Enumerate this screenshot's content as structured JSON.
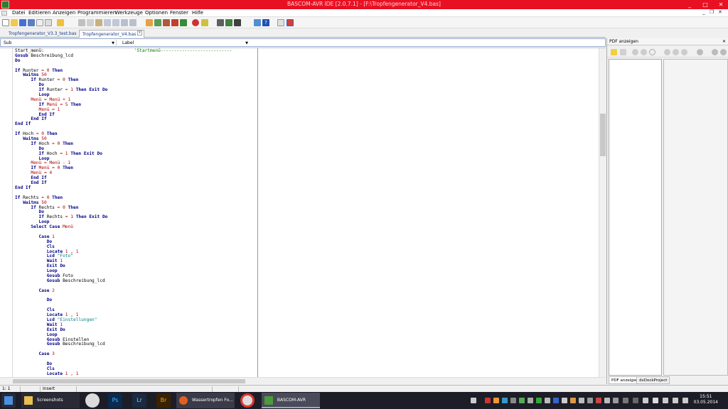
{
  "window": {
    "title": "BASCOM-AVR IDE [2.0.7.1] - [F:\\Tropfengenerator_V4.bas]",
    "min": "_",
    "max": "□",
    "close": "✕"
  },
  "menu": {
    "items": [
      "Datei",
      "Editieren",
      "Anzeigen",
      "Programmieren",
      "Werkzeuge",
      "Optionen",
      "Fenster",
      "Hilfe"
    ],
    "doc_min": "_",
    "doc_restore": "❐",
    "doc_close": "✕"
  },
  "tabs": [
    {
      "label": "Tropfengenerator_V3.3_test.bas"
    },
    {
      "label": "Tropfengenerator_V4.bas"
    }
  ],
  "selectors": {
    "sub": "Sub",
    "label": "Label"
  },
  "code_lines": [
    [
      [
        "t",
        "Start_menü:"
      ],
      [
        "pad",
        "                                  "
      ],
      [
        "cm",
        "'Startmenü---------------------------"
      ]
    ],
    [
      [
        "kw",
        "Gosub"
      ],
      [
        "t",
        " Beschreibung_lcd"
      ]
    ],
    [
      [
        "kw",
        "Do"
      ]
    ],
    [
      [
        "t",
        ""
      ]
    ],
    [
      [
        "kw",
        "If"
      ],
      [
        "t",
        " Runter "
      ],
      [
        "num",
        "= 0"
      ],
      [
        "kw",
        " Then"
      ]
    ],
    [
      [
        "t",
        "   "
      ],
      [
        "kw",
        "Waitms"
      ],
      [
        "num",
        " 50"
      ]
    ],
    [
      [
        "t",
        "      "
      ],
      [
        "kw",
        "If"
      ],
      [
        "t",
        " Runter "
      ],
      [
        "num",
        "= 0"
      ],
      [
        "kw",
        " Then"
      ]
    ],
    [
      [
        "t",
        "         "
      ],
      [
        "kw",
        "Do"
      ]
    ],
    [
      [
        "t",
        "         "
      ],
      [
        "kw",
        "If"
      ],
      [
        "t",
        " Runter "
      ],
      [
        "num",
        "= 1"
      ],
      [
        "kw",
        " Then Exit Do"
      ]
    ],
    [
      [
        "t",
        "         "
      ],
      [
        "kw",
        "Loop"
      ]
    ],
    [
      [
        "t",
        "      "
      ],
      [
        "var",
        "Menü"
      ],
      [
        "num",
        " = "
      ],
      [
        "var",
        "Menü"
      ],
      [
        "num",
        " + 1"
      ]
    ],
    [
      [
        "t",
        "         "
      ],
      [
        "kw",
        "If"
      ],
      [
        "var",
        " Menü"
      ],
      [
        "num",
        " = 5"
      ],
      [
        "kw",
        " Then"
      ]
    ],
    [
      [
        "t",
        "         "
      ],
      [
        "var",
        "Menü"
      ],
      [
        "num",
        " = 1"
      ]
    ],
    [
      [
        "t",
        "         "
      ],
      [
        "kw",
        "End If"
      ]
    ],
    [
      [
        "t",
        "      "
      ],
      [
        "kw",
        "End If"
      ]
    ],
    [
      [
        "kw",
        "End If"
      ]
    ],
    [
      [
        "t",
        ""
      ]
    ],
    [
      [
        "kw",
        "If"
      ],
      [
        "t",
        " Hoch "
      ],
      [
        "num",
        "= 0"
      ],
      [
        "kw",
        " Then"
      ]
    ],
    [
      [
        "t",
        "   "
      ],
      [
        "kw",
        "Waitms"
      ],
      [
        "num",
        " 50"
      ]
    ],
    [
      [
        "t",
        "      "
      ],
      [
        "kw",
        "If"
      ],
      [
        "t",
        " Hoch "
      ],
      [
        "num",
        "= 0"
      ],
      [
        "kw",
        " Then"
      ]
    ],
    [
      [
        "t",
        "         "
      ],
      [
        "kw",
        "Do"
      ]
    ],
    [
      [
        "t",
        "         "
      ],
      [
        "kw",
        "If"
      ],
      [
        "t",
        " Hoch "
      ],
      [
        "num",
        "= 1"
      ],
      [
        "kw",
        " Then Exit Do"
      ]
    ],
    [
      [
        "t",
        "         "
      ],
      [
        "kw",
        "Loop"
      ]
    ],
    [
      [
        "t",
        "      "
      ],
      [
        "var",
        "Menü"
      ],
      [
        "num",
        " = "
      ],
      [
        "var",
        "Menü"
      ],
      [
        "num",
        " - 1"
      ]
    ],
    [
      [
        "t",
        "      "
      ],
      [
        "kw",
        "If"
      ],
      [
        "var",
        " Menü"
      ],
      [
        "num",
        " = 0"
      ],
      [
        "kw",
        " Then"
      ]
    ],
    [
      [
        "t",
        "      "
      ],
      [
        "var",
        "Menü"
      ],
      [
        "num",
        " = 4"
      ]
    ],
    [
      [
        "t",
        "      "
      ],
      [
        "kw",
        "End If"
      ]
    ],
    [
      [
        "t",
        "      "
      ],
      [
        "kw",
        "End If"
      ]
    ],
    [
      [
        "kw",
        "End If"
      ]
    ],
    [
      [
        "t",
        ""
      ]
    ],
    [
      [
        "kw",
        "If"
      ],
      [
        "t",
        " Rechts "
      ],
      [
        "num",
        "= 0"
      ],
      [
        "kw",
        " Then"
      ]
    ],
    [
      [
        "t",
        "   "
      ],
      [
        "kw",
        "Waitms"
      ],
      [
        "num",
        " 50"
      ]
    ],
    [
      [
        "t",
        "      "
      ],
      [
        "kw",
        "If"
      ],
      [
        "t",
        " Rechts "
      ],
      [
        "num",
        "= 0"
      ],
      [
        "kw",
        " Then"
      ]
    ],
    [
      [
        "t",
        "         "
      ],
      [
        "kw",
        "Do"
      ]
    ],
    [
      [
        "t",
        "         "
      ],
      [
        "kw",
        "If"
      ],
      [
        "t",
        " Rechts "
      ],
      [
        "num",
        "= 1"
      ],
      [
        "kw",
        " Then Exit Do"
      ]
    ],
    [
      [
        "t",
        "         "
      ],
      [
        "kw",
        "Loop"
      ]
    ],
    [
      [
        "t",
        "      "
      ],
      [
        "kw",
        "Select Case"
      ],
      [
        "var",
        " Menü"
      ]
    ],
    [
      [
        "t",
        ""
      ]
    ],
    [
      [
        "t",
        "         "
      ],
      [
        "kw",
        "Case"
      ],
      [
        "num",
        " 1"
      ]
    ],
    [
      [
        "t",
        "            "
      ],
      [
        "kw",
        "Do"
      ]
    ],
    [
      [
        "t",
        "            "
      ],
      [
        "kw",
        "Cls"
      ]
    ],
    [
      [
        "t",
        "            "
      ],
      [
        "kw",
        "Locate"
      ],
      [
        "num",
        " 1 , 1"
      ]
    ],
    [
      [
        "t",
        "            "
      ],
      [
        "kw",
        "Lcd"
      ],
      [
        "str",
        " \"Foto\""
      ]
    ],
    [
      [
        "t",
        "            "
      ],
      [
        "kw",
        "Wait"
      ],
      [
        "num",
        " 1"
      ]
    ],
    [
      [
        "t",
        "            "
      ],
      [
        "kw",
        "Exit Do"
      ]
    ],
    [
      [
        "t",
        "            "
      ],
      [
        "kw",
        "Loop"
      ]
    ],
    [
      [
        "t",
        "            "
      ],
      [
        "kw",
        "Gosub"
      ],
      [
        "t",
        " Foto"
      ]
    ],
    [
      [
        "t",
        "            "
      ],
      [
        "kw",
        "Gosub"
      ],
      [
        "t",
        " Beschreibung_lcd"
      ]
    ],
    [
      [
        "t",
        ""
      ]
    ],
    [
      [
        "t",
        "         "
      ],
      [
        "kw",
        "Case"
      ],
      [
        "num",
        " 2"
      ]
    ],
    [
      [
        "t",
        ""
      ]
    ],
    [
      [
        "t",
        "            "
      ],
      [
        "kw",
        "Do"
      ]
    ],
    [
      [
        "t",
        ""
      ]
    ],
    [
      [
        "t",
        "            "
      ],
      [
        "kw",
        "Cls"
      ]
    ],
    [
      [
        "t",
        "            "
      ],
      [
        "kw",
        "Locate"
      ],
      [
        "num",
        " 1 , 1"
      ]
    ],
    [
      [
        "t",
        "            "
      ],
      [
        "kw",
        "Lcd"
      ],
      [
        "str",
        " \"Einstellungen\""
      ]
    ],
    [
      [
        "t",
        "            "
      ],
      [
        "kw",
        "Wait"
      ],
      [
        "num",
        " 1"
      ]
    ],
    [
      [
        "t",
        "            "
      ],
      [
        "kw",
        "Exit Do"
      ]
    ],
    [
      [
        "t",
        "            "
      ],
      [
        "kw",
        "Loop"
      ]
    ],
    [
      [
        "t",
        "            "
      ],
      [
        "kw",
        "Gosub"
      ],
      [
        "t",
        " Einstellen"
      ]
    ],
    [
      [
        "t",
        "            "
      ],
      [
        "kw",
        "Gosub"
      ],
      [
        "t",
        " Beschreibung_lcd"
      ]
    ],
    [
      [
        "t",
        ""
      ]
    ],
    [
      [
        "t",
        "         "
      ],
      [
        "kw",
        "Case"
      ],
      [
        "num",
        " 3"
      ]
    ],
    [
      [
        "t",
        ""
      ]
    ],
    [
      [
        "t",
        "            "
      ],
      [
        "kw",
        "Do"
      ]
    ],
    [
      [
        "t",
        "            "
      ],
      [
        "kw",
        "Cls"
      ]
    ],
    [
      [
        "t",
        "            "
      ],
      [
        "kw",
        "Locate"
      ],
      [
        "num",
        " 1 , 1"
      ]
    ]
  ],
  "colors": {
    "keyword": "#00008b",
    "string": "#008080",
    "number": "#b00000",
    "comment": "#008000"
  },
  "pdf_panel": {
    "title": "PDF anzeigen",
    "tabs": [
      "PDF anzeigen",
      "dxDockProject"
    ]
  },
  "status": {
    "position": "1: 1",
    "mode": "Insert"
  },
  "taskbar": {
    "apps": [
      "Screenshots",
      "Wassertropfen Fo...",
      "BASCOM-AVR"
    ],
    "icon_labels": {
      "ps": "Ps",
      "lr": "Lr",
      "br": "Br"
    },
    "time": "15:51",
    "date": "03.05.2014"
  }
}
